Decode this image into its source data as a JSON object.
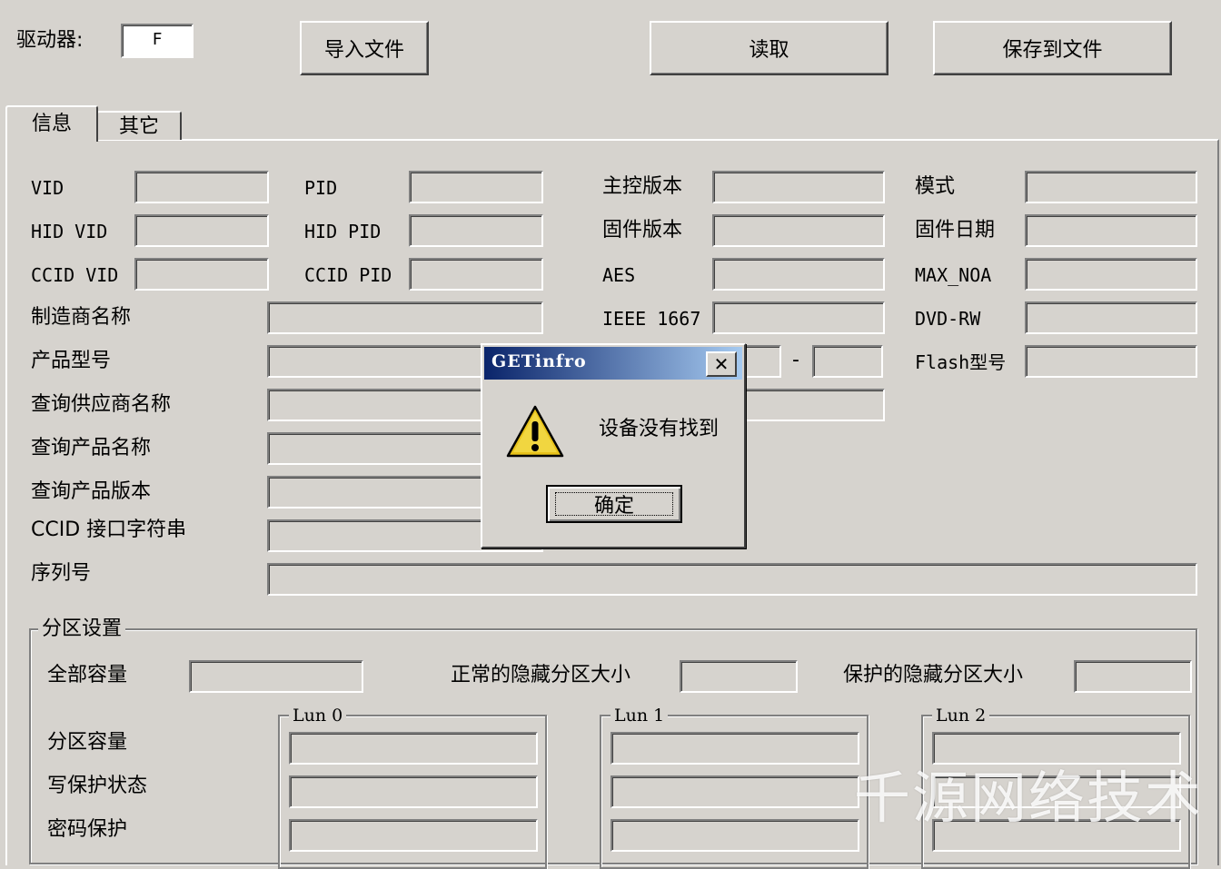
{
  "toolbar": {
    "drive_label": "驱动器:",
    "drive_value": "F",
    "import_label": "导入文件",
    "read_label": "读取",
    "save_label": "保存到文件"
  },
  "tabs": [
    {
      "label": "信息",
      "active": true
    },
    {
      "label": "其它",
      "active": false
    }
  ],
  "info": {
    "vid": "VID",
    "pid": "PID",
    "hid_vid": "HID VID",
    "hid_pid": "HID PID",
    "ccid_vid": "CCID VID",
    "ccid_pid": "CCID PID",
    "controller_version": "主控版本",
    "firmware_version": "固件版本",
    "aes": "AES",
    "ieee": "IEEE 1667",
    "mode": "模式",
    "firmware_date": "固件日期",
    "max_noa": "MAX_NOA",
    "dvd_rw": "DVD-RW",
    "flash_model": "Flash型号",
    "manufacturer": "制造商名称",
    "product_model": "产品型号",
    "query_vendor": "查询供应商名称",
    "query_product_name": "查询产品名称",
    "query_product_version": "查询产品版本",
    "ccid_interface": "CCID 接口字符串",
    "serial": "序列号",
    "dash": "-"
  },
  "partition": {
    "title": "分区设置",
    "total_capacity": "全部容量",
    "normal_hidden": "正常的隐藏分区大小",
    "protected_hidden": "保护的隐藏分区大小",
    "partition_capacity": "分区容量",
    "write_protect": "写保护状态",
    "password_protect": "密码保护",
    "luns": [
      "Lun 0",
      "Lun 1",
      "Lun 2"
    ]
  },
  "dialog": {
    "title": "GETinfro",
    "message": "设备没有找到",
    "ok_label": "确定",
    "close_symbol": "✕"
  },
  "watermark": "千源网络技术"
}
